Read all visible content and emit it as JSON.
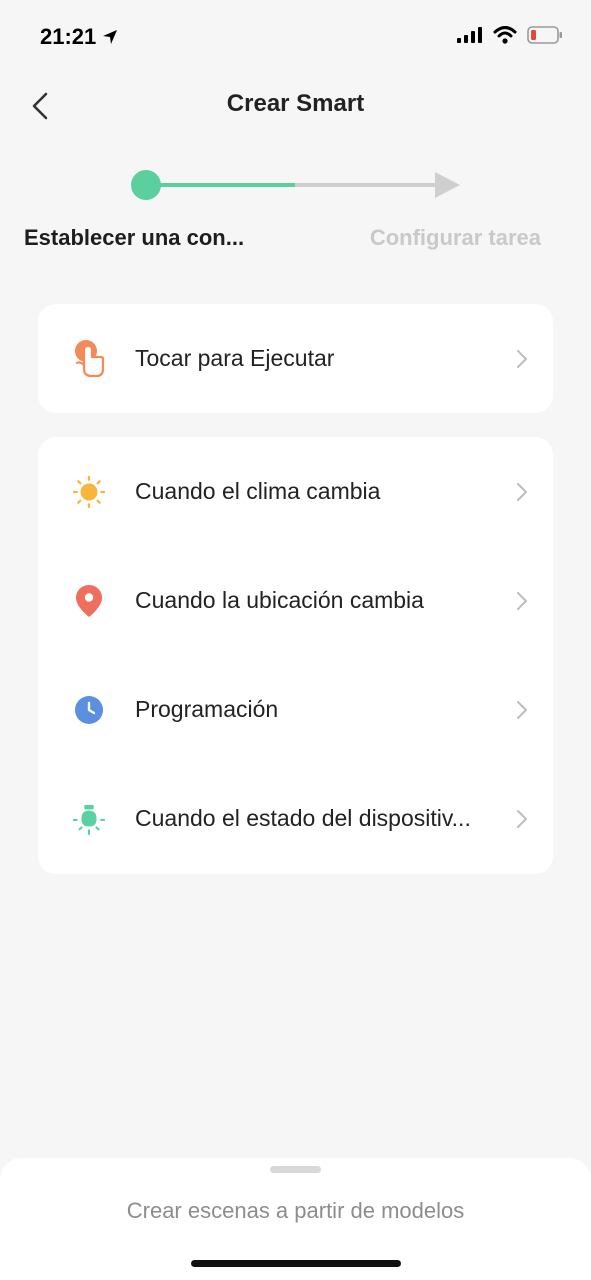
{
  "status_bar": {
    "time": "21:21"
  },
  "header": {
    "title": "Crear Smart"
  },
  "stepper": {
    "step1_label": "Establecer una con...",
    "step2_label": "Configurar tarea",
    "active_color": "#5ccf9f",
    "inactive_color": "#cfcfcf"
  },
  "manual_card": {
    "items": [
      {
        "label": "Tocar para Ejecutar",
        "icon": "tap-hand-icon",
        "color": "#f28a5a"
      }
    ]
  },
  "auto_card": {
    "items": [
      {
        "label": "Cuando el clima cambia",
        "icon": "sun-icon",
        "color": "#f7b53b"
      },
      {
        "label": "Cuando la ubicación cambia",
        "icon": "location-pin-icon",
        "color": "#ef6f5f"
      },
      {
        "label": "Programación",
        "icon": "clock-icon",
        "color": "#5b8fe0"
      },
      {
        "label": "Cuando el estado del dispositiv...",
        "icon": "device-bulb-icon",
        "color": "#5ad1a3"
      }
    ]
  },
  "bottom_sheet": {
    "label": "Crear escenas a partir de modelos"
  }
}
